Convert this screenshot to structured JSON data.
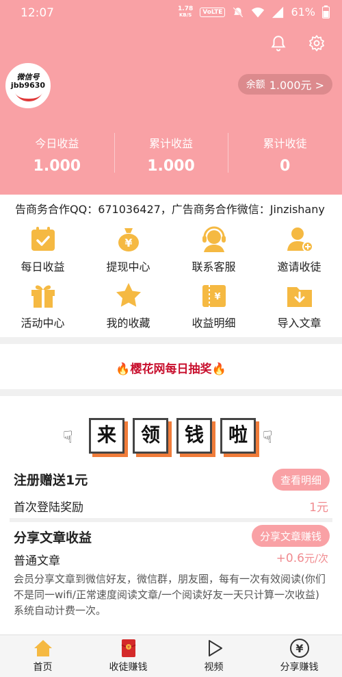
{
  "status": {
    "time": "12:07",
    "speed_value": "1.78",
    "speed_unit": "KB/S",
    "volte": "VoLTE",
    "battery": "61%"
  },
  "header": {
    "avatar_line1": "微信号",
    "avatar_line2": "jbb9630",
    "balance_label": "余额",
    "balance_value": "1.000元 >",
    "stats": [
      {
        "label": "今日收益",
        "value": "1.000"
      },
      {
        "label": "累计收益",
        "value": "1.000"
      },
      {
        "label": "累计收徒",
        "value": "0"
      }
    ],
    "icons": [
      "bell-icon",
      "gear-icon"
    ]
  },
  "marquee": "告商务合作QQ：671036427，广告商务合作微信：Jinzishany",
  "grid": [
    {
      "label": "每日收益",
      "icon": "calendar-check-icon"
    },
    {
      "label": "提现中心",
      "icon": "money-bag-icon"
    },
    {
      "label": "联系客服",
      "icon": "headset-icon"
    },
    {
      "label": "邀请收徒",
      "icon": "add-user-icon"
    },
    {
      "label": "活动中心",
      "icon": "gift-icon"
    },
    {
      "label": "我的收藏",
      "icon": "star-icon"
    },
    {
      "label": "收益明细",
      "icon": "ticket-icon"
    },
    {
      "label": "导入文章",
      "icon": "folder-download-icon"
    }
  ],
  "lottery": "🔥樱花网每日抽奖🔥",
  "card": {
    "banner_chars": [
      "来",
      "领",
      "钱",
      "啦"
    ],
    "register": {
      "title": "注册赠送1元",
      "button": "查看明细",
      "sub": "首次登陆奖励",
      "value": "1元"
    },
    "share": {
      "title": "分享文章收益",
      "button": "分享文章赚钱",
      "sub": "普通文章",
      "value": "+0.6",
      "unit": "元/次",
      "desc": "会员分享文章到微信好友，微信群，朋友圈，每有一次有效阅读(你们不是同一wifi/正常速度阅读文章/一个阅读好友一天只计算一次收益)系统自动计费一次。"
    }
  },
  "tabs": [
    {
      "label": "首页",
      "icon": "home-icon"
    },
    {
      "label": "收徒赚钱",
      "icon": "red-envelope-icon"
    },
    {
      "label": "视频",
      "icon": "play-icon"
    },
    {
      "label": "分享赚钱",
      "icon": "yen-coin-icon"
    }
  ],
  "colors": {
    "header": "#f9a1a5",
    "accent_red": "#c8102e",
    "icon_orange": "#f5b942",
    "pink_text": "#f08a8f"
  }
}
